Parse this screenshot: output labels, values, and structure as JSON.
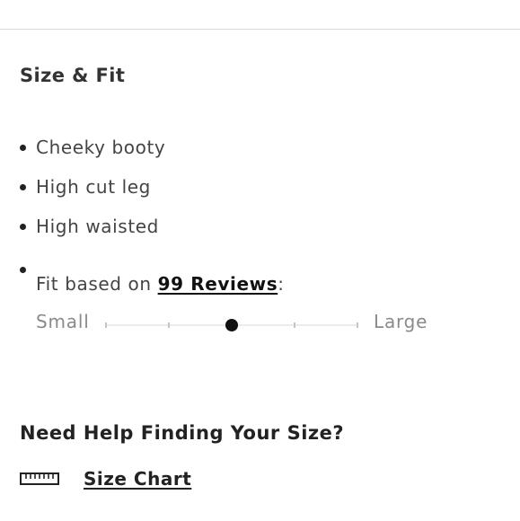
{
  "section": {
    "title": "Size & Fit"
  },
  "bullets": [
    {
      "text": "Cheeky booty"
    },
    {
      "text": "High cut leg"
    },
    {
      "text": "High waisted"
    }
  ],
  "fit": {
    "prefix": "Fit based on ",
    "reviews_link": "99 Reviews",
    "suffix": ":",
    "scale": {
      "min_label": "Small",
      "max_label": "Large",
      "steps": 5,
      "selected_step": 3,
      "selected_fraction": 0.5
    }
  },
  "help": {
    "title": "Need Help Finding Your Size?",
    "size_chart_label": "Size Chart",
    "icon": "ruler-icon"
  },
  "colors": {
    "text": "#333333",
    "link": "#111111",
    "muted": "#8a8a8a",
    "track": "#ececec",
    "marker": "#111111",
    "divider": "#d9d9d9"
  }
}
